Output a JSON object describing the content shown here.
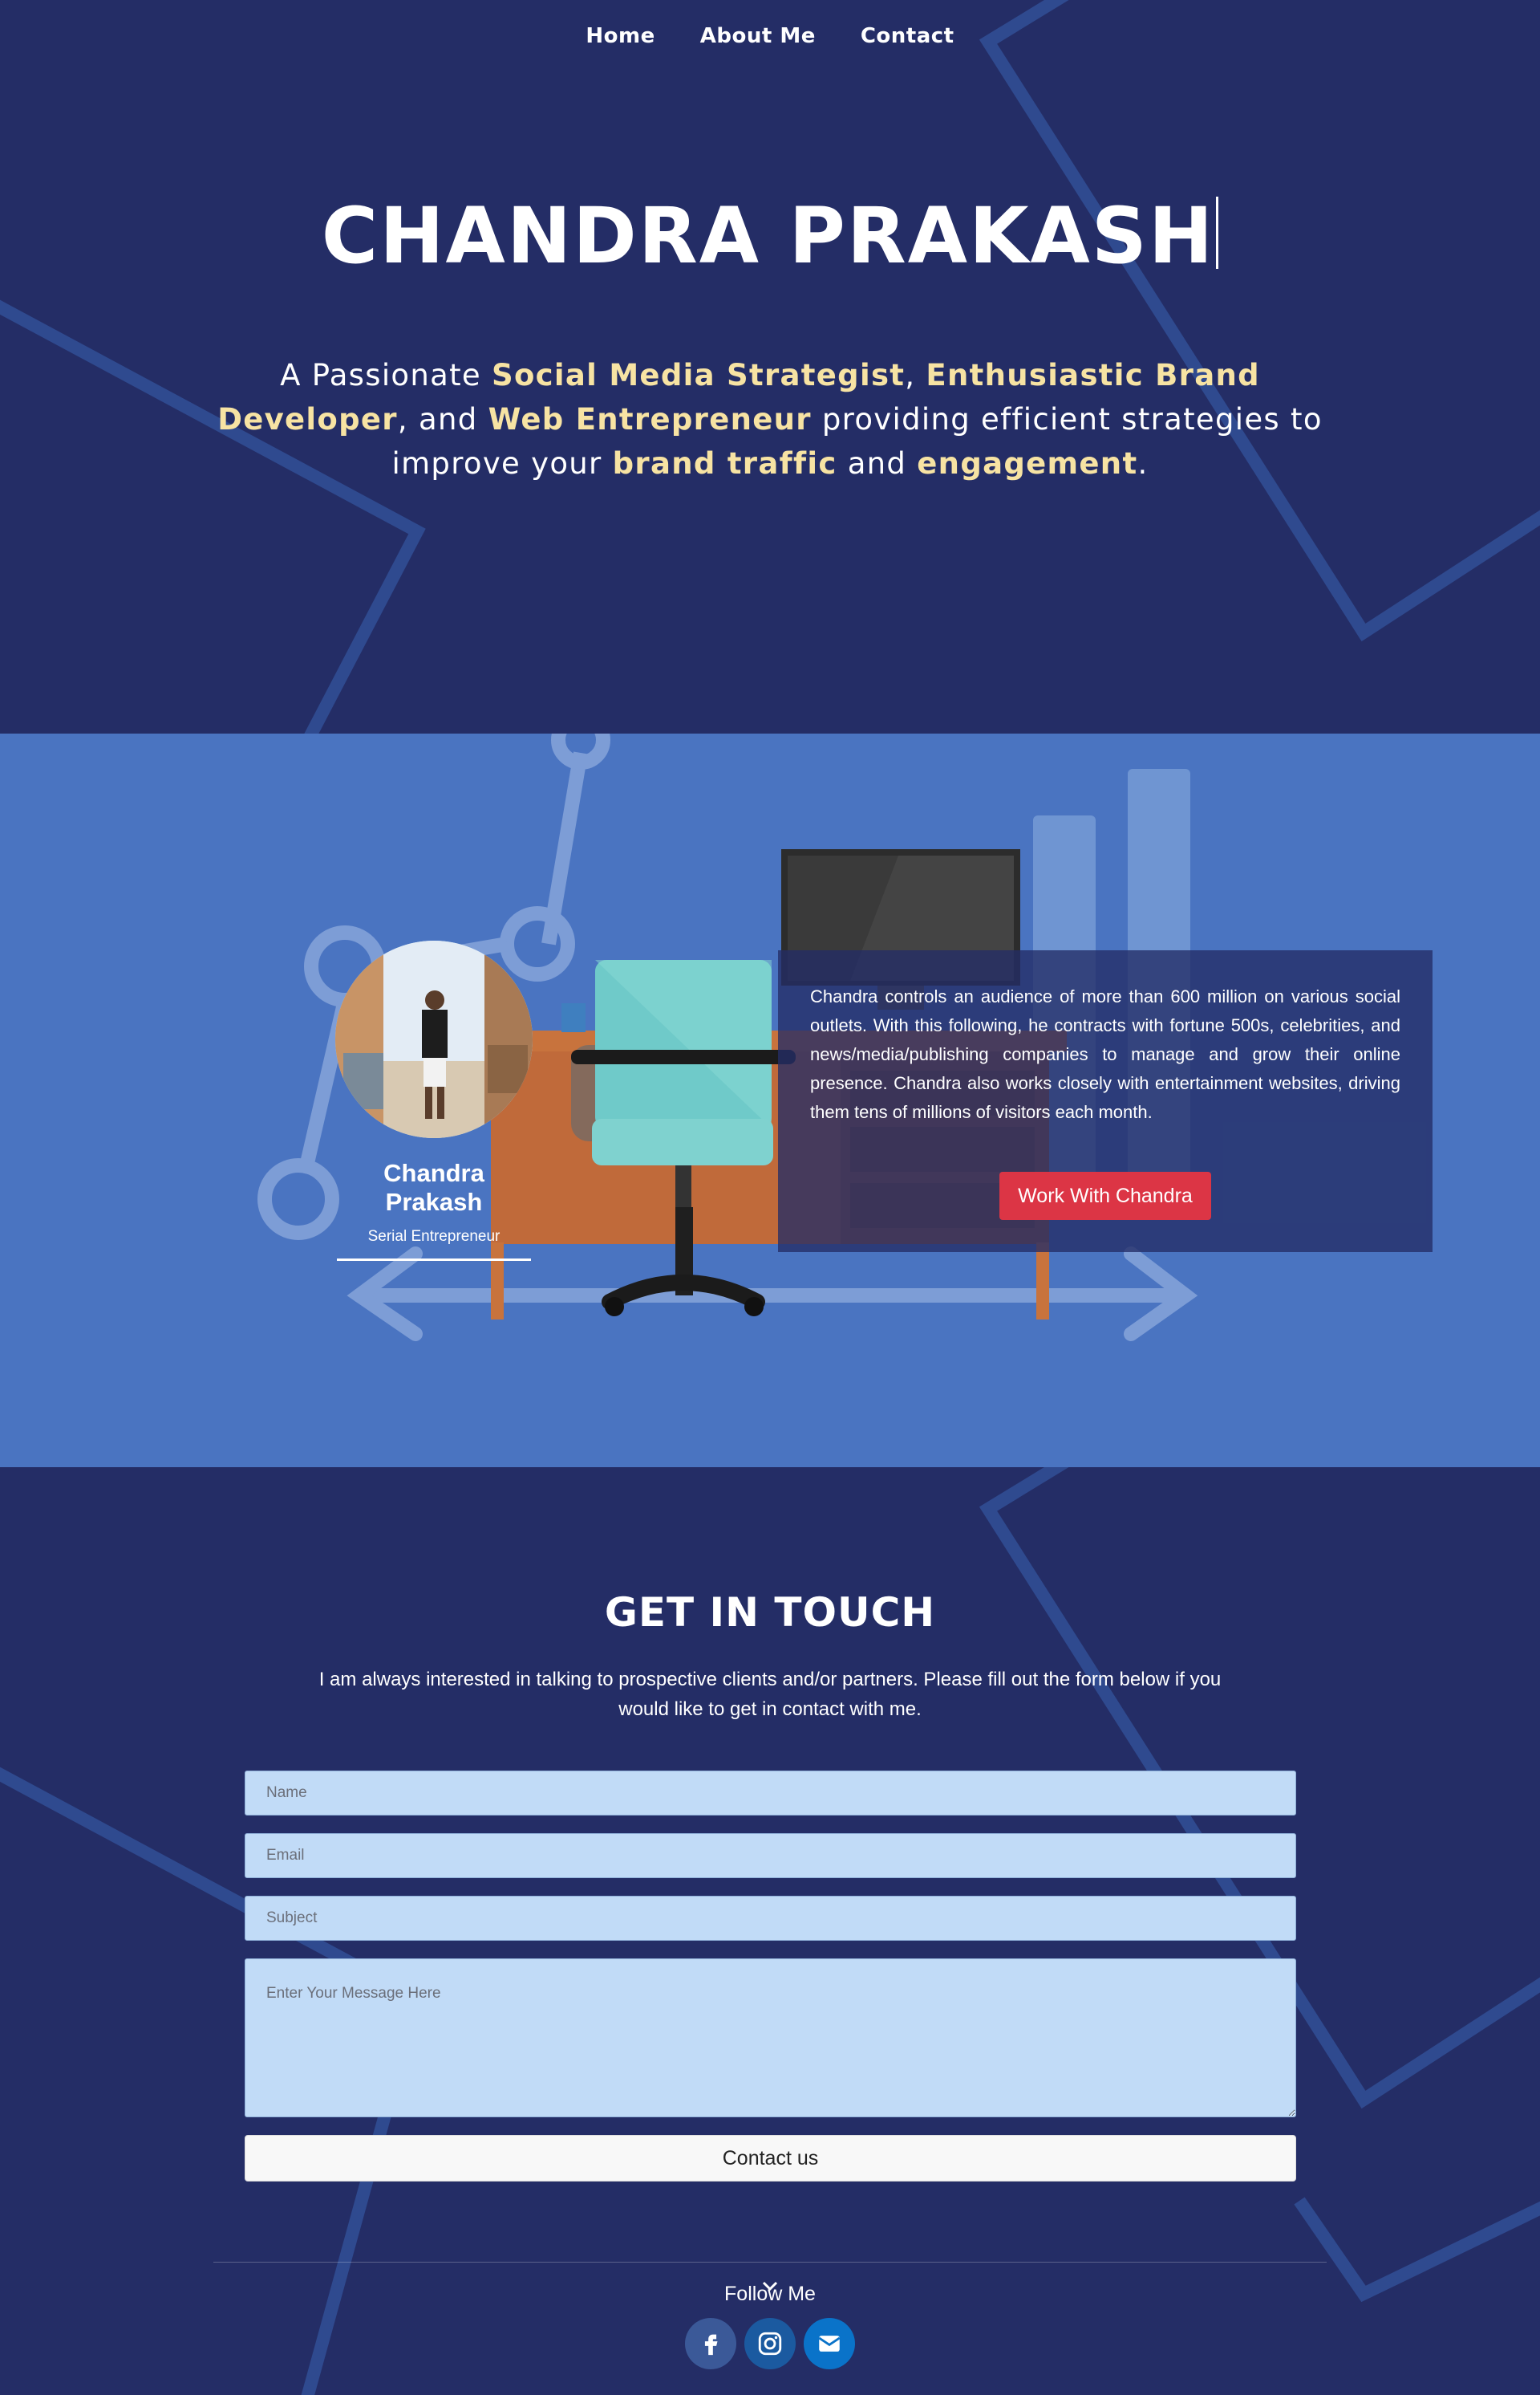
{
  "nav": {
    "items": [
      "Home",
      "About Me",
      "Contact"
    ]
  },
  "hero": {
    "title": "CHANDRA PRAKASH",
    "tagline": {
      "p1": "A Passionate ",
      "h1": "Social Media Strategist",
      "p2": ", ",
      "h2": "Enthusiastic Brand Developer",
      "p3": ", and ",
      "h3": "Web Entrepreneur",
      "p4": " providing efficient strategies to improve your ",
      "h4": "brand traffic",
      "p5": " and ",
      "h5": "engagement",
      "p6": "."
    }
  },
  "about": {
    "name": "Chandra Prakash",
    "role": "Serial Entrepreneur",
    "text": "Chandra controls an audience of more than 600 million on various social outlets. With this following, he contracts with fortune 500s, celebrities, and news/media/publishing companies to manage and grow their online presence. Chandra also works closely with entertainment websites, driving them tens of millions of visitors each month.",
    "button": "Work With Chandra"
  },
  "contact": {
    "title": "GET IN TOUCH",
    "subtitle": "I am always interested in talking to prospective clients and/or partners. Please fill out the form below if you would like to get in contact with me.",
    "placeholders": {
      "name": "Name",
      "email": "Email",
      "subject": "Subject",
      "message": "Enter Your Message Here"
    },
    "submit": "Contact us",
    "follow": "Follow Me",
    "socials": [
      "facebook-icon",
      "instagram-icon",
      "envelope-icon"
    ]
  },
  "colors": {
    "navy": "#242d66",
    "blue": "#4a74c1",
    "highlight": "#f7e3a3",
    "cta_red": "#dc3545",
    "field_bg": "#c1dbf7"
  }
}
